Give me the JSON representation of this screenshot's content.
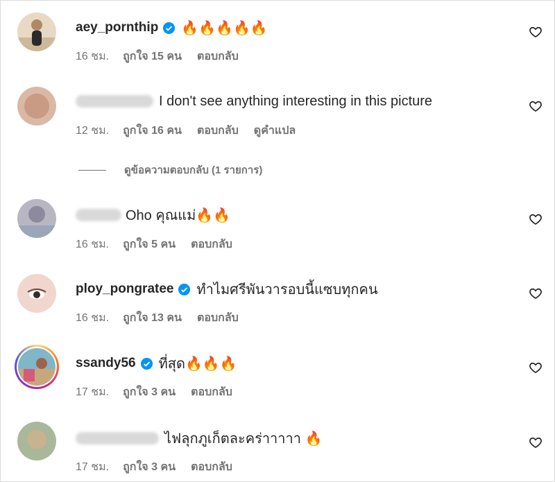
{
  "comments": [
    {
      "username": "aey_pornthip",
      "verified": true,
      "text": "🔥🔥🔥🔥🔥",
      "time": "16 ชม.",
      "likes": "ถูกใจ 15 คน",
      "reply": "ตอบกลับ",
      "translate": ""
    },
    {
      "username": "",
      "verified": false,
      "text": "I don't see anything interesting in this picture",
      "time": "12 ชม.",
      "likes": "ถูกใจ 16 คน",
      "reply": "ตอบกลับ",
      "translate": "ดูคำแปล"
    },
    {
      "username": "",
      "verified": false,
      "text": "Oho คุณแม่🔥🔥",
      "time": "16 ชม.",
      "likes": "ถูกใจ 5 คน",
      "reply": "ตอบกลับ",
      "translate": ""
    },
    {
      "username": "ploy_pongratee",
      "verified": true,
      "text": "ทำไมศรีพันวารอบนี้แซบทุกคน",
      "time": "16 ชม.",
      "likes": "ถูกใจ 13 คน",
      "reply": "ตอบกลับ",
      "translate": ""
    },
    {
      "username": "ssandy56",
      "verified": true,
      "text": "ที่สุด🔥🔥🔥",
      "time": "17 ชม.",
      "likes": "ถูกใจ 3 คน",
      "reply": "ตอบกลับ",
      "translate": ""
    },
    {
      "username": "",
      "verified": false,
      "text": "ไฟลุกภูเก็ตละคร่าาาาา 🔥",
      "time": "17 ชม.",
      "likes": "ถูกใจ 3 คน",
      "reply": "ตอบกลับ",
      "translate": ""
    }
  ],
  "view_replies": "ดูข้อความตอบกลับ (1 รายการ)",
  "colors": {
    "verified": "#0095f6",
    "secondary": "#737373",
    "primary": "#262626"
  },
  "icons": {
    "like": "heart-outline-icon",
    "verified": "verified-badge-icon"
  }
}
